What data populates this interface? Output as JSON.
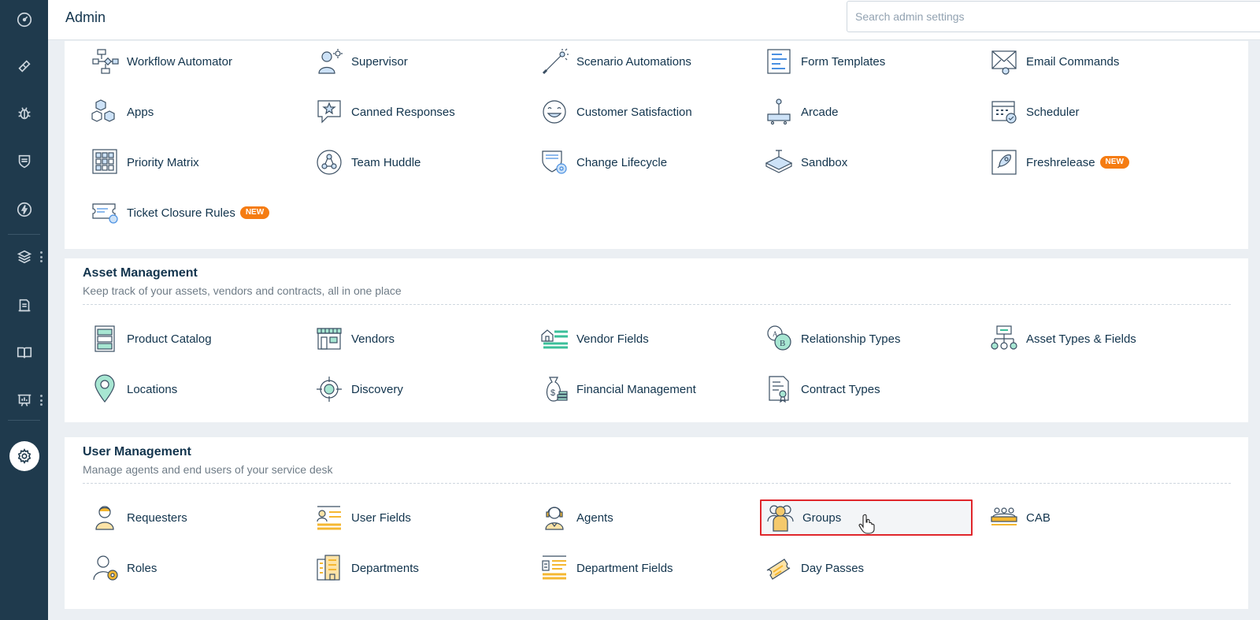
{
  "header": {
    "title": "Admin",
    "search_placeholder": "Search admin settings"
  },
  "leftnav": {
    "icons": [
      "dashboard-icon",
      "tickets-icon",
      "problems-icon",
      "changes-icon",
      "releases-icon",
      "assets-icon",
      "solutions-icon",
      "knowledge-base-icon",
      "reports-icon",
      "admin-gear-icon"
    ]
  },
  "workflow": {
    "items": [
      {
        "label": "Workflow Automator"
      },
      {
        "label": "Supervisor"
      },
      {
        "label": "Scenario Automations"
      },
      {
        "label": "Form Templates"
      },
      {
        "label": "Email Commands"
      },
      {
        "label": "Apps"
      },
      {
        "label": "Canned Responses"
      },
      {
        "label": "Customer Satisfaction"
      },
      {
        "label": "Arcade"
      },
      {
        "label": "Scheduler"
      },
      {
        "label": "Priority Matrix"
      },
      {
        "label": "Team Huddle"
      },
      {
        "label": "Change Lifecycle"
      },
      {
        "label": "Sandbox"
      },
      {
        "label": "Freshrelease",
        "badge": "NEW"
      },
      {
        "label": "Ticket Closure Rules",
        "badge": "NEW"
      }
    ]
  },
  "asset_management": {
    "title": "Asset Management",
    "description": "Keep track of your assets, vendors and contracts, all in one place",
    "items": [
      {
        "label": "Product Catalog"
      },
      {
        "label": "Vendors"
      },
      {
        "label": "Vendor Fields"
      },
      {
        "label": "Relationship Types"
      },
      {
        "label": "Asset Types & Fields"
      },
      {
        "label": "Locations"
      },
      {
        "label": "Discovery"
      },
      {
        "label": "Financial Management"
      },
      {
        "label": "Contract Types"
      }
    ]
  },
  "user_management": {
    "title": "User Management",
    "description": "Manage agents and end users of your service desk",
    "items": [
      {
        "label": "Requesters"
      },
      {
        "label": "User Fields"
      },
      {
        "label": "Agents"
      },
      {
        "label": "Groups"
      },
      {
        "label": "CAB"
      },
      {
        "label": "Roles"
      },
      {
        "label": "Departments"
      },
      {
        "label": "Department Fields"
      },
      {
        "label": "Day Passes"
      }
    ]
  },
  "colors": {
    "nav_bg": "#1f3a4d",
    "accent_blue": "#4a90e2",
    "accent_green": "#3bbf9a",
    "accent_yellow": "#f5b731",
    "badge_orange": "#f57c12",
    "highlight_red": "#e0262b"
  }
}
